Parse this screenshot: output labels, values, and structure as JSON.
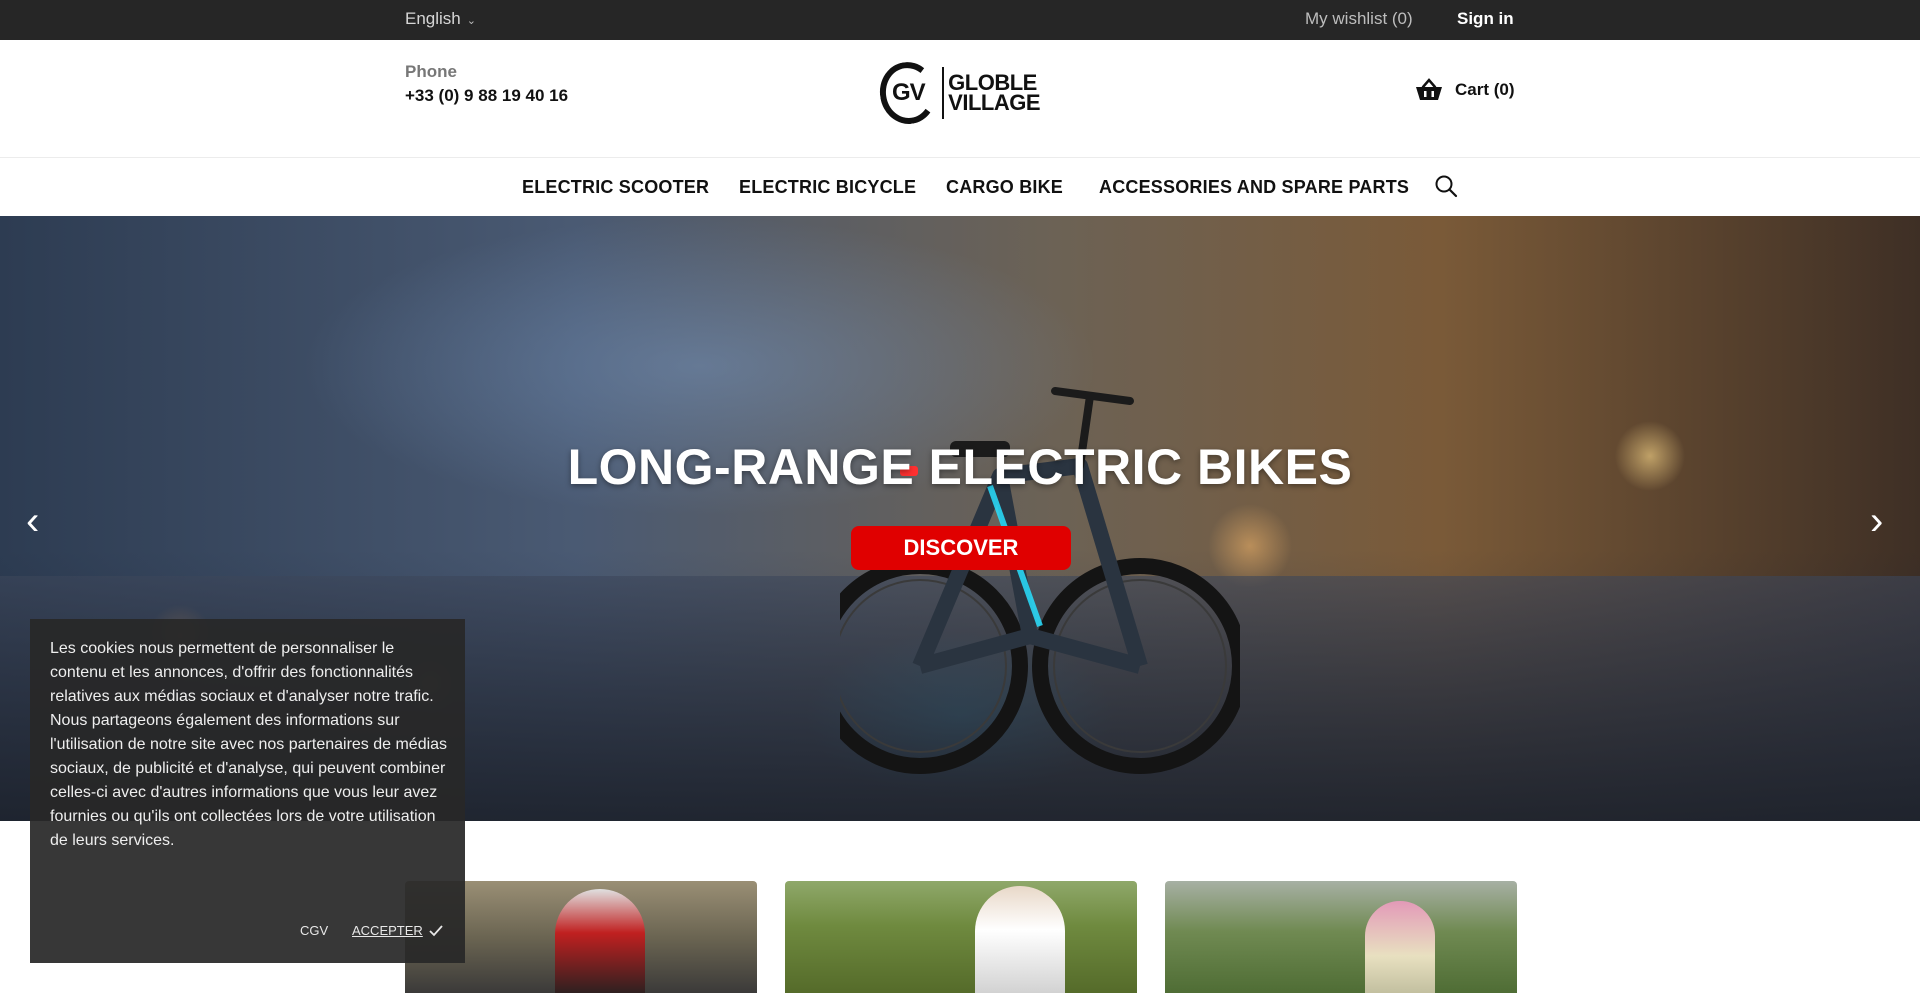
{
  "topbar": {
    "language": "English",
    "wishlist": "My wishlist (0)",
    "signin": "Sign in"
  },
  "header": {
    "phone_label": "Phone",
    "phone_number": "+33 (0) 9 88 19 40 16",
    "logo": {
      "monogram": "GV",
      "line1": "GLOBLE",
      "line2": "VILLAGE"
    },
    "cart": "Cart (0)"
  },
  "nav": {
    "items": [
      {
        "label": "ELECTRIC SCOOTER"
      },
      {
        "label": "ELECTRIC BICYCLE"
      },
      {
        "label": "CARGO BIKE"
      },
      {
        "label": "ACCESSORIES AND SPARE PARTS"
      }
    ]
  },
  "hero": {
    "title": "LONG-RANGE ELECTRIC BIKES",
    "button": "DISCOVER"
  },
  "cookie": {
    "text": "Les cookies nous permettent de personnaliser le contenu et les annonces, d'offrir des fonctionnalités relatives aux médias sociaux et d'analyser notre trafic. Nous partageons également des informations sur l'utilisation de notre site avec nos partenaires de médias sociaux, de publicité et d'analyse, qui peuvent combiner celles-ci avec d'autres informations que vous leur avez fournies ou qu'ils ont collectées lors de votre utilisation de leurs services.",
    "cgv": "CGV",
    "accept": "ACCEPTER"
  },
  "colors": {
    "topbar_bg": "#262626",
    "accent_red": "#e00000",
    "cookie_bg": "#282828"
  }
}
